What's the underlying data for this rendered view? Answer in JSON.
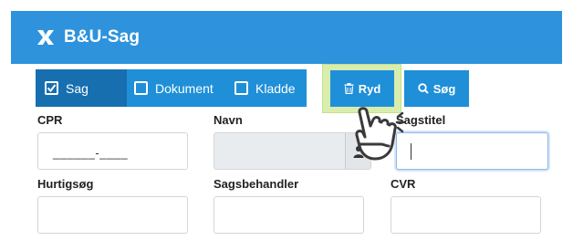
{
  "app": {
    "title": "B&U-Sag",
    "logo_icon": "x-cross-logo"
  },
  "tabs": [
    {
      "label": "Sag",
      "checked": true,
      "active": true
    },
    {
      "label": "Dokument",
      "checked": false,
      "active": false
    },
    {
      "label": "Kladde",
      "checked": false,
      "active": false
    }
  ],
  "buttons": {
    "clear": {
      "label": "Ryd",
      "icon": "trash-icon"
    },
    "search": {
      "label": "Søg",
      "icon": "search-icon"
    }
  },
  "fields": {
    "cpr": {
      "label": "CPR",
      "mask": "______-____"
    },
    "navn": {
      "label": "Navn",
      "value": ""
    },
    "sagstitel": {
      "label": "Sagstitel",
      "value": ""
    },
    "hurtigsog": {
      "label": "Hurtigsøg",
      "value": ""
    },
    "sagsbehandler": {
      "label": "Sagsbehandler",
      "value": ""
    },
    "cvr": {
      "label": "CVR",
      "value": ""
    }
  },
  "colors": {
    "header": "#2e93dc",
    "tab_bar": "#1f8fd8",
    "tab_active": "#176fb0",
    "highlight": "#d9edad"
  }
}
